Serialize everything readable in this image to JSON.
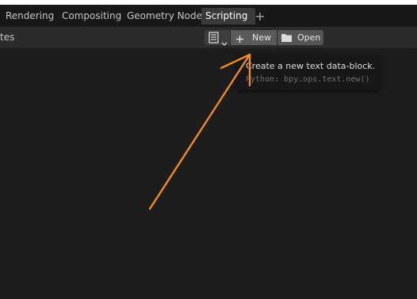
{
  "workspace_tabs": [
    {
      "label": "Rendering",
      "active": false
    },
    {
      "label": "Compositing",
      "active": false
    },
    {
      "label": "Geometry Nodes",
      "active": false
    },
    {
      "label": "Scripting",
      "active": true
    }
  ],
  "add_tab_label": "+",
  "header": {
    "left_text": "tes",
    "new_label": "New",
    "open_label": "Open"
  },
  "tooltip": {
    "title": "Create a new text data-block.",
    "python": "Python: bpy.ops.text.new()"
  },
  "icons": [
    "text-datablock-icon",
    "chevron-down-icon",
    "plus-icon",
    "folder-icon"
  ],
  "colors": {
    "accent_arrow": "#f08a24",
    "active_tab": "#3a3a3a",
    "background": "#1d1d1d"
  }
}
